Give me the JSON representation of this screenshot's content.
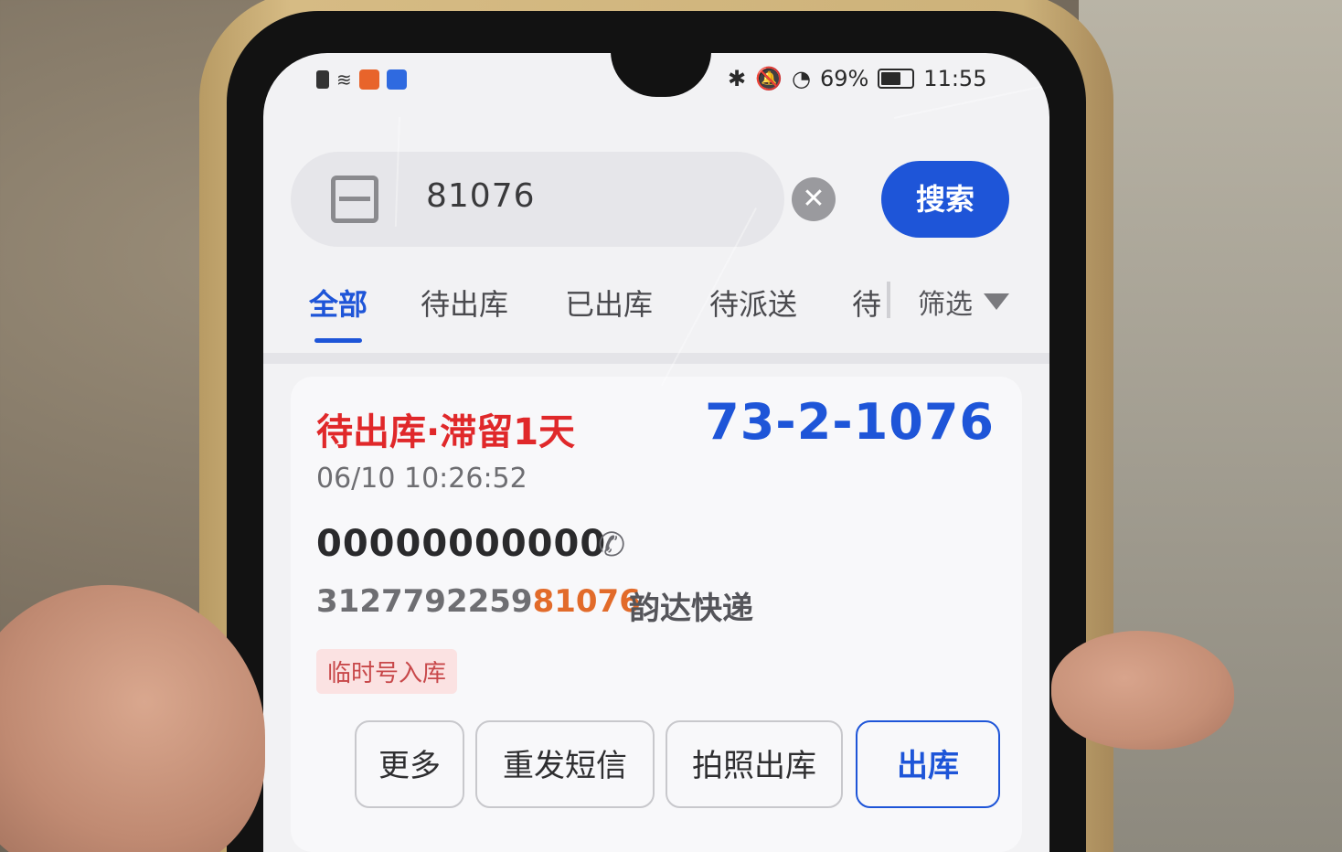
{
  "status_bar": {
    "battery": "69%",
    "time": "11:55"
  },
  "search": {
    "query": "81076",
    "clear_glyph": "✕",
    "button_label": "搜索"
  },
  "tabs": [
    {
      "label": "全部",
      "active": true
    },
    {
      "label": "待出库",
      "active": false
    },
    {
      "label": "已出库",
      "active": false
    },
    {
      "label": "待派送",
      "active": false
    },
    {
      "label": "待",
      "active": false
    }
  ],
  "filter": {
    "label": "筛选",
    "icon": "funnel-icon"
  },
  "package": {
    "status": "待出库·滞留1天",
    "shelf_code": "73-2-1076",
    "timestamp": "06/10 10:26:52",
    "phone": "00000000000",
    "tracking_prefix": "3127792259",
    "tracking_highlight": "81076",
    "courier": "韵达快递",
    "tag": "临时号入库"
  },
  "actions": {
    "more": "更多",
    "resend_sms": "重发短信",
    "photo_checkout": "拍照出库",
    "checkout": "出库"
  },
  "colors": {
    "accent_blue": "#1e55d8",
    "status_red": "#e0282a",
    "highlight_orange": "#e26b2a"
  }
}
